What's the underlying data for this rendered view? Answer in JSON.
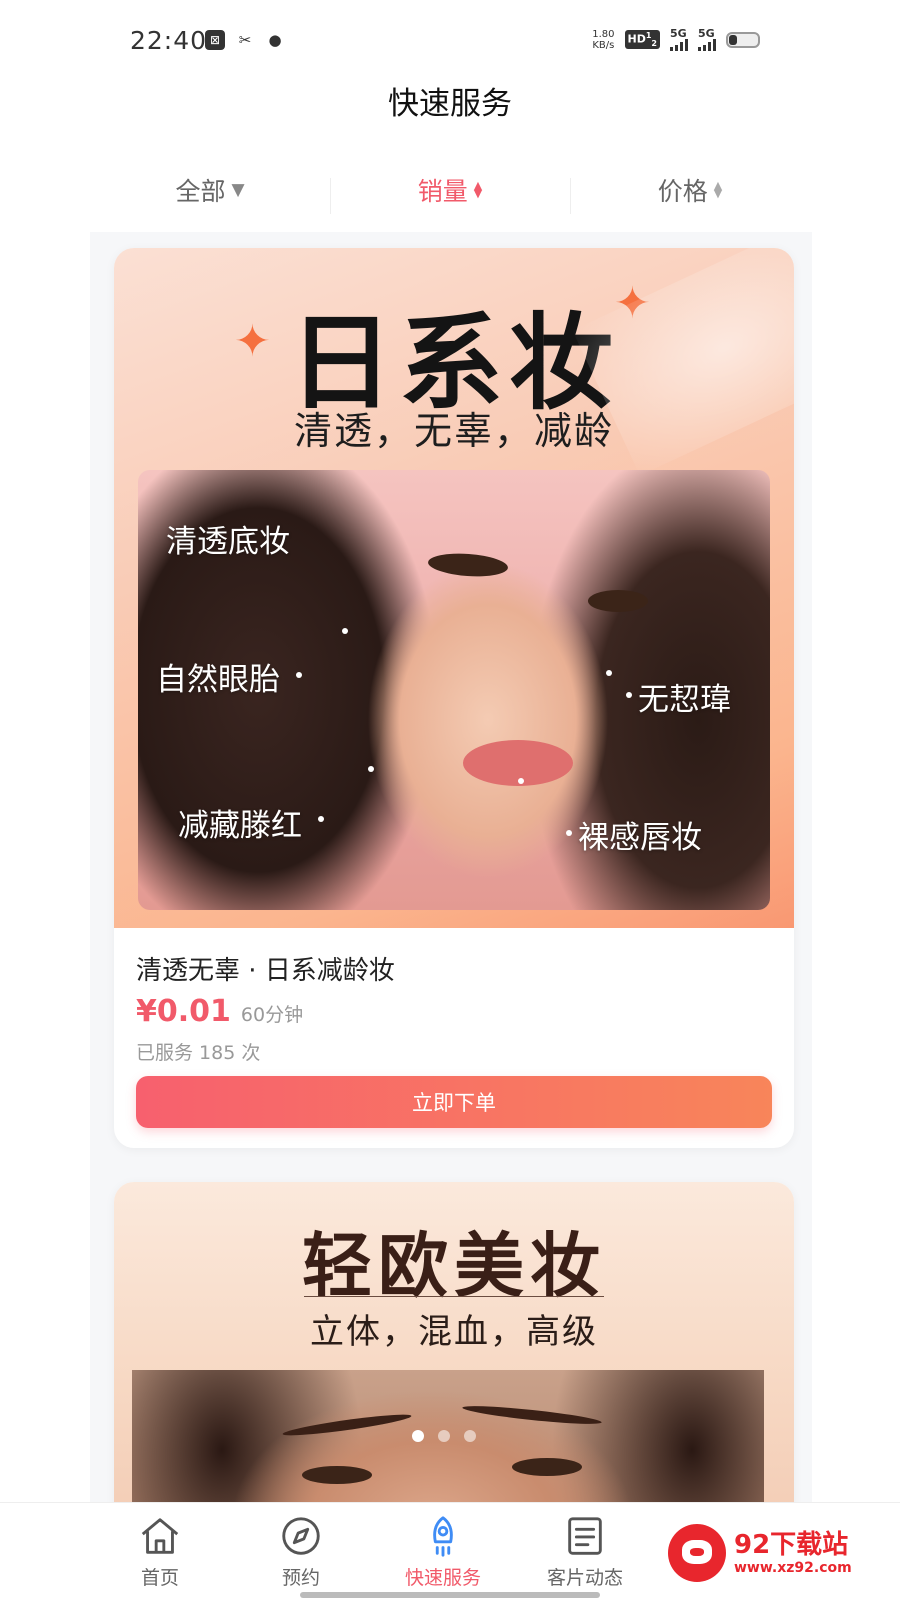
{
  "status_bar": {
    "time": "22:40",
    "net_speed_value": "1.80",
    "net_speed_unit": "KB/s",
    "hd": "HD",
    "hd_sup": "1",
    "hd_sub": "2",
    "sim1": "5G",
    "sim2": "5G",
    "icons_left": [
      "app-icon",
      "tools-icon",
      "chat-icon"
    ]
  },
  "header": {
    "title": "快速服务"
  },
  "filters": [
    {
      "label": "全部",
      "indicator": "▼"
    },
    {
      "label": "销量",
      "indicator": "sort",
      "active": true
    },
    {
      "label": "价格",
      "indicator": "sort"
    }
  ],
  "cards": [
    {
      "banner_title": "日系妆",
      "banner_subtitle": "清透，无辜，减龄",
      "photo_labels": [
        "清透底妆",
        "自然眼胎",
        "无恝瑋",
        "减藏滕红",
        "裸感唇妆"
      ],
      "name": "清透无辜 · 日系减龄妆",
      "price": "¥0.01",
      "duration": "60分钟",
      "served": "已服务 185 次",
      "button": "立即下单"
    },
    {
      "banner_title": "轻欧美妆",
      "banner_subtitle": "立体，混血，高级"
    }
  ],
  "carousel": {
    "count": 3,
    "active_index": 0
  },
  "bottom_nav": [
    {
      "label": "首页",
      "icon": "home-icon"
    },
    {
      "label": "预约",
      "icon": "compass-icon"
    },
    {
      "label": "快速服务",
      "icon": "rocket-icon",
      "active": true
    },
    {
      "label": "客片动态",
      "icon": "document-icon"
    }
  ],
  "watermark": {
    "main": "92下载站",
    "sub": "www.xz92.com"
  },
  "colors": {
    "accent": "#f15a6a",
    "button_start": "#f7606e",
    "button_end": "#f8855a"
  }
}
